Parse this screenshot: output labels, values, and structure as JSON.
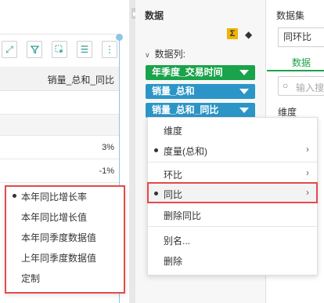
{
  "table": {
    "column_header": "销量_总和_同比",
    "rows": [
      "3%",
      "-1%"
    ]
  },
  "toolbar": {
    "icons": [
      "expand-icon",
      "filter-icon",
      "select-icon",
      "list-icon",
      "more-icon"
    ]
  },
  "data_panel": {
    "title": "数据",
    "section_label": "数据列:",
    "fields": [
      {
        "label": "年季度_交易时间",
        "color": "#1aa34a"
      },
      {
        "label": "销量_总和",
        "color": "#2c95c7"
      },
      {
        "label": "销量_总和_同比",
        "color": "#2c95c7"
      }
    ]
  },
  "right_panel": {
    "title": "数据集",
    "dataset_value": "同环比",
    "tab_label": "数据",
    "search_placeholder": "输入搜",
    "dimension_label": "维度"
  },
  "context_menu": {
    "items": [
      {
        "label": "维度",
        "bullet": false,
        "submenu": false
      },
      {
        "label": "度量(总和)",
        "bullet": true,
        "submenu": true
      },
      {
        "label": "环比",
        "bullet": false,
        "submenu": true
      },
      {
        "label": "同比",
        "bullet": true,
        "submenu": true,
        "highlighted": true
      },
      {
        "label": "删除同比",
        "bullet": false,
        "submenu": false
      },
      {
        "label": "别名...",
        "bullet": false,
        "submenu": false
      },
      {
        "label": "删除",
        "bullet": false,
        "submenu": false
      }
    ],
    "arrow_glyph": "›"
  },
  "sub_menu": {
    "items": [
      {
        "label": "本年同比增长率",
        "selected": true
      },
      {
        "label": "本年同比增长值",
        "selected": false
      },
      {
        "label": "本年同季度数据值",
        "selected": false
      },
      {
        "label": "上年同季度数据值",
        "selected": false
      },
      {
        "label": "定制",
        "selected": false
      }
    ]
  },
  "colors": {
    "accent_green": "#1aa34a",
    "accent_blue": "#2c95c7",
    "highlight_red": "#e64a4a",
    "sigma_yellow": "#f0b400"
  }
}
